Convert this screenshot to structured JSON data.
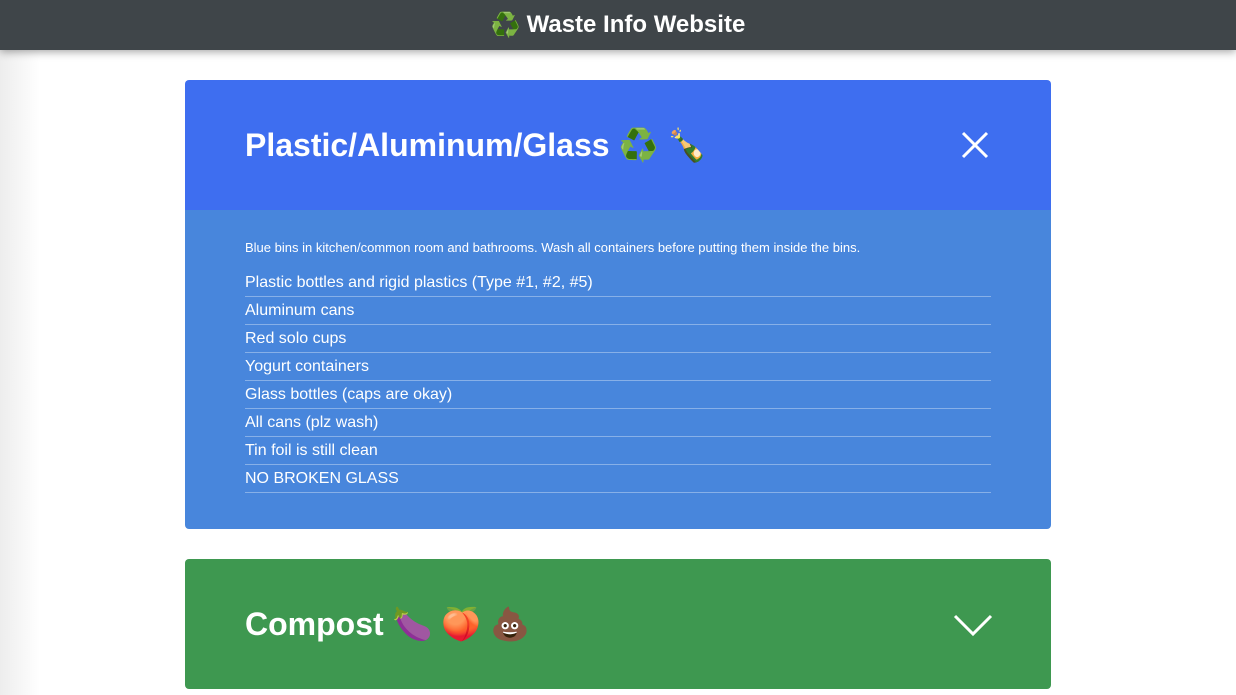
{
  "header": {
    "logo_icon": "recycle-icon",
    "logo_glyph": "♻️",
    "title": "Waste Info Website"
  },
  "panels": [
    {
      "title": "Plastic/Aluminum/Glass ♻️ 🍾",
      "state": "expanded",
      "toggle_icon": "close-icon",
      "color": "#3e6ef0",
      "body_color": "#4886dc",
      "intro": "Blue bins in kitchen/common room and bathrooms. Wash all containers before putting them inside the bins.",
      "items": [
        "Plastic bottles and rigid plastics (Type #1, #2, #5)",
        "Aluminum cans",
        "Red solo cups",
        "Yogurt containers",
        "Glass bottles (caps are okay)",
        "All cans (plz wash)",
        "Tin foil is still clean",
        "NO BROKEN GLASS"
      ]
    },
    {
      "title": "Compost 🍆 🍑 💩",
      "state": "collapsed",
      "toggle_icon": "chevron-down-icon",
      "color": "#3e9850"
    }
  ]
}
